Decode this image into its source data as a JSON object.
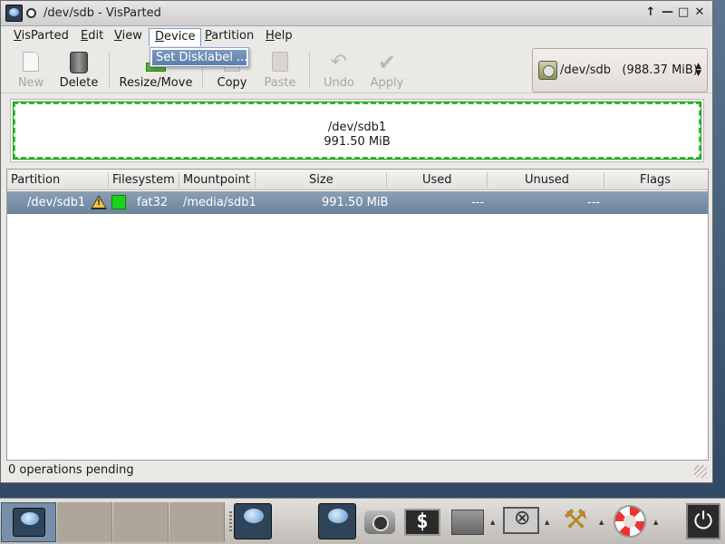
{
  "window": {
    "title": "/dev/sdb - VisParted",
    "buttons": [
      "↑",
      "—",
      "□",
      "✕"
    ]
  },
  "menubar": {
    "items": [
      {
        "label": "VisParted",
        "mnemonic": "V"
      },
      {
        "label": "Edit",
        "mnemonic": "E"
      },
      {
        "label": "View",
        "mnemonic": "V"
      },
      {
        "label": "Device",
        "mnemonic": "D",
        "active": true
      },
      {
        "label": "Partition",
        "mnemonic": "P"
      },
      {
        "label": "Help",
        "mnemonic": "H"
      }
    ]
  },
  "device_menu": {
    "items": [
      {
        "label": "Set Disklabel ..."
      }
    ]
  },
  "toolbar": {
    "new_label": "New",
    "delete_label": "Delete",
    "resize_label": "Resize/Move",
    "copy_label": "Copy",
    "paste_label": "Paste",
    "undo_label": "Undo",
    "apply_label": "Apply"
  },
  "device_select": {
    "value": "/dev/sdb   (988.37 MiB)",
    "arrows": "▲\n▼"
  },
  "disk_map": {
    "partition_name": "/dev/sdb1",
    "partition_size": "991.50 MiB",
    "partition_color": "#28c828"
  },
  "table": {
    "columns": [
      "Partition",
      "Filesystem",
      "Mountpoint",
      "Size",
      "Used",
      "Unused",
      "Flags"
    ],
    "rows": [
      {
        "partition": "/dev/sdb1",
        "warning": "!",
        "fs_color": "#1dd11d",
        "filesystem": "fat32",
        "mountpoint": "/media/sdb1",
        "size": "991.50 MiB",
        "used": "---",
        "unused": "---",
        "flags": ""
      }
    ]
  },
  "status": {
    "text": "0 operations pending"
  },
  "taskbar": {
    "launchers": [
      "visparted-icon",
      "camera-icon",
      "terminal-icon",
      "folder-icon",
      "monitor-icon",
      "tools-icon",
      "help-icon"
    ],
    "terminal_glyph": "$",
    "tools_glyph": "⚒",
    "power_glyph": "⏻",
    "menu_arrow": "▲"
  }
}
